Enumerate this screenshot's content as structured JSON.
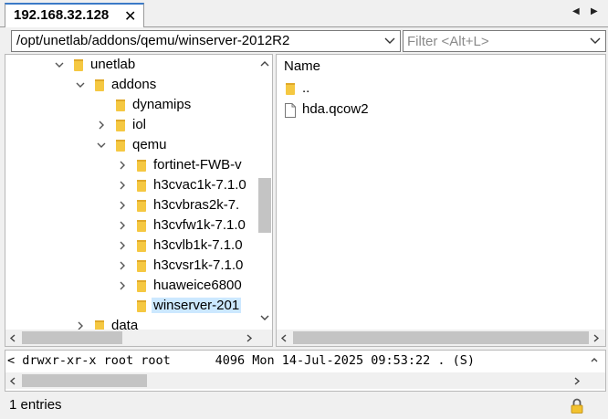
{
  "tab": {
    "title": "192.168.32.128",
    "close_glyph": "✕",
    "nav_prev": "◀",
    "nav_next": "▶"
  },
  "path_bar": {
    "path": "/opt/unetlab/addons/qemu/winserver-2012R2",
    "filter_placeholder": "Filter <Alt+L>",
    "filter_value": ""
  },
  "tree": {
    "nodes": [
      {
        "label": "unetlab",
        "state": "expanded",
        "icon": "folder-icon"
      },
      {
        "label": "addons",
        "state": "expanded",
        "icon": "folder-icon"
      },
      {
        "label": "dynamips",
        "state": "leaf",
        "icon": "folder-icon"
      },
      {
        "label": "iol",
        "state": "collapsed",
        "icon": "folder-icon"
      },
      {
        "label": "qemu",
        "state": "expanded",
        "icon": "folder-icon"
      },
      {
        "label": "fortinet-FWB-v",
        "state": "collapsed",
        "icon": "folder-icon"
      },
      {
        "label": "h3cvac1k-7.1.0",
        "state": "collapsed",
        "icon": "folder-icon"
      },
      {
        "label": "h3cvbras2k-7.",
        "state": "collapsed",
        "icon": "folder-icon"
      },
      {
        "label": "h3cvfw1k-7.1.0",
        "state": "collapsed",
        "icon": "folder-icon"
      },
      {
        "label": "h3cvlb1k-7.1.0",
        "state": "collapsed",
        "icon": "folder-icon"
      },
      {
        "label": "h3cvsr1k-7.1.0",
        "state": "collapsed",
        "icon": "folder-icon"
      },
      {
        "label": "huaweice6800",
        "state": "collapsed",
        "icon": "folder-icon"
      },
      {
        "label": "winserver-201",
        "state": "leaf",
        "selected": true,
        "icon": "folder-icon"
      },
      {
        "label": "data",
        "state": "collapsed",
        "icon": "folder-icon"
      }
    ]
  },
  "file_list": {
    "column_name": "Name",
    "items": [
      {
        "name": "..",
        "icon": "folder-icon"
      },
      {
        "name": "hda.qcow2",
        "icon": "file-icon"
      }
    ]
  },
  "log": {
    "line": "< drwxr-xr-x root root      4096 Mon 14-Jul-2025 09:53:22 . (S)"
  },
  "status": {
    "entries": "1 entries",
    "lock_icon": "lock-icon"
  },
  "colors": {
    "accent": "#3b7ac7",
    "selection": "#cce8ff",
    "folder": "#f5c842"
  }
}
